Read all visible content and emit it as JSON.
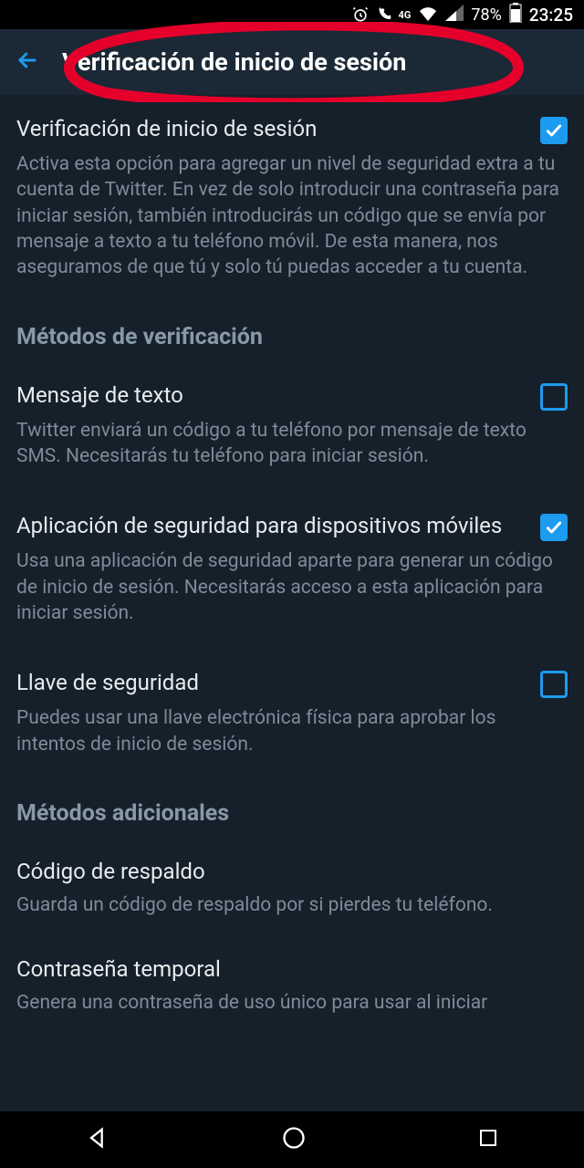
{
  "status": {
    "battery_pct": "78%",
    "time": "23:25",
    "network_badge": "4G"
  },
  "header": {
    "title": "Verificación de inicio de sesión"
  },
  "main": {
    "login_verification": {
      "title": "Verificación de inicio de sesión",
      "desc": "Activa esta opción para agregar un nivel de seguridad extra a tu cuenta de Twitter. En vez de solo introducir una contraseña para iniciar sesión, también introducirás un código que se envía por mensaje a texto a tu teléfono móvil. De esta manera, nos aseguramos de que tú y solo tú puedas acceder a tu cuenta.",
      "checked": true
    }
  },
  "groups": {
    "verification_methods": {
      "header": "Métodos de verificación",
      "items": {
        "sms": {
          "title": "Mensaje de texto",
          "desc": "Twitter enviará un código a tu teléfono por mensaje de texto SMS. Necesitarás tu teléfono para iniciar sesión.",
          "checked": false
        },
        "auth_app": {
          "title": "Aplicación de seguridad para dispositivos móviles",
          "desc": "Usa una aplicación de seguridad aparte para generar un código de inicio de sesión. Necesitarás acceso a esta aplicación para iniciar sesión.",
          "checked": true
        },
        "security_key": {
          "title": "Llave de seguridad",
          "desc": "Puedes usar una llave electrónica física para aprobar los intentos de inicio de sesión.",
          "checked": false
        }
      }
    },
    "additional_methods": {
      "header": "Métodos adicionales",
      "items": {
        "backup_code": {
          "title": "Código de respaldo",
          "desc": "Guarda un código de respaldo por si pierdes tu teléfono."
        },
        "temp_password": {
          "title": "Contraseña temporal",
          "desc": "Genera una contraseña de uso único para usar al iniciar"
        }
      }
    }
  }
}
